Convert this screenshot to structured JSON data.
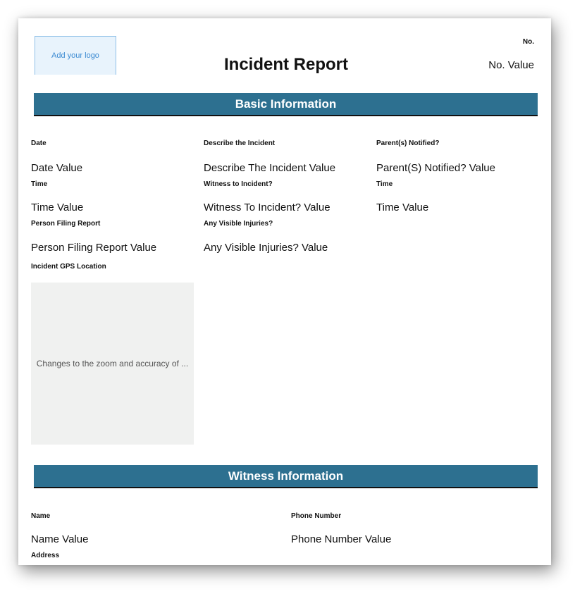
{
  "header": {
    "logo_text": "Add your logo",
    "title": "Incident Report",
    "no_label": "No.",
    "no_value": "No. Value"
  },
  "basic": {
    "heading": "Basic Information",
    "date_label": "Date",
    "date_value": "Date Value",
    "time_label": "Time",
    "time_value": "Time Value",
    "person_label": "Person Filing Report",
    "person_value": "Person Filing Report Value",
    "gps_label": "Incident GPS Location",
    "map_text": "Changes to the zoom and accuracy of ...",
    "describe_label": "Describe the Incident",
    "describe_value": "Describe The Incident Value",
    "witness_label": "Witness to Incident?",
    "witness_value": "Witness To Incident? Value",
    "injuries_label": "Any Visible Injuries?",
    "injuries_value": "Any Visible Injuries? Value",
    "parents_label": "Parent(s) Notified?",
    "parents_value": "Parent(S) Notified? Value",
    "time2_label": "Time",
    "time2_value": "Time Value"
  },
  "witness_info": {
    "heading": "Witness Information",
    "name_label": "Name",
    "name_value": "Name Value",
    "phone_label": "Phone Number",
    "phone_value": "Phone Number Value",
    "address_label": "Address"
  }
}
